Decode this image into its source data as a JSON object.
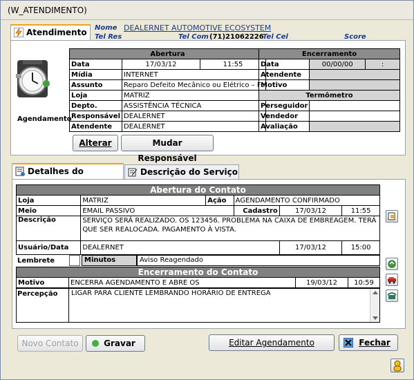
{
  "window": {
    "title": "(W_ATENDIMENTO)"
  },
  "tab_atendimento": {
    "label": "Atendimento"
  },
  "header": {
    "nome_label": "Nome",
    "nome_value": "DEALERNET AUTOMOTIVE ECOSYSTEM",
    "telres_label": "Tel Res",
    "telcom_label": "Tel Com",
    "telcom_value": "(71)21062226",
    "telcel_label": "Tel Cel",
    "score_label": "Score"
  },
  "agendamento_label": "Agendamento",
  "abertura": {
    "title": "Abertura",
    "data_label": "Data",
    "data_value": "17/03/12",
    "hora_value": "11:55",
    "midia_label": "Mídia",
    "midia_value": "INTERNET",
    "assunto_label": "Assunto",
    "assunto_value": "Reparo Defeito Mecânico ou Elétrico – Fo",
    "loja_label": "Loja",
    "loja_value": "MATRIZ",
    "depto_label": "Depto.",
    "depto_value": "ASSISTÊNCIA TÉCNICA",
    "responsavel_label": "Responsável",
    "responsavel_value": "DEALERNET",
    "atendente_label": "Atendente",
    "atendente_value": "DEALERNET"
  },
  "encerramento": {
    "title": "Encerramento",
    "data_label": "Data",
    "data_value": "00/00/00",
    "hora_value": ":",
    "atendente_label": "Atendente",
    "motivo_label": "Motivo",
    "termometro_title": "Termômetro",
    "perseguidor_label": "Perseguidor",
    "vendedor_label": "Vendedor",
    "avaliacao_label": "Avaliação"
  },
  "buttons": {
    "alterar": "Alterar",
    "mudar_responsavel": "Mudar Responsável",
    "novo_contato": "Novo Contato",
    "gravar": "Gravar",
    "editar_agendamento": "Editar Agendamento",
    "fechar": "Fechar"
  },
  "tabs2": {
    "detalhes": "Detalhes do Contato",
    "descricao": "Descrição do Serviço"
  },
  "contato": {
    "abertura_title": "Abertura do Contato",
    "loja_label": "Loja",
    "loja_value": "MATRIZ",
    "acao_label": "Ação",
    "acao_value": "AGENDAMENTO CONFIRMADO",
    "meio_label": "Meio",
    "meio_value": "EMAIL PASSIVO",
    "cadastro_label": "Cadastro",
    "cadastro_date": "17/03/12",
    "cadastro_time": "11:55",
    "descricao_label": "Descrição",
    "descricao_value": "SERVIÇO SERÁ REALIZADO. OS 123456. PROBLEMA NA CAIXA DE EMBREAGEM. TERÁ QUE SER REALOCADA. PAGAMENTO À VISTA.",
    "usuario_label": "Usuário/Data",
    "usuario_value": "DEALERNET",
    "usuario_date": "17/03/12",
    "usuario_time": "15:00",
    "lembrete_label": "Lembrete",
    "minutos_label": "Minutos Antes",
    "minutos_value": "Aviso Reagendado",
    "encerramento_title": "Encerramento do Contato",
    "motivo_label": "Motivo",
    "motivo_value": "ENCERRA AGENDAMENTO E ABRE OS",
    "motivo_date": "19/03/12",
    "motivo_time": "10:59",
    "percepcao_label": "Percepção",
    "percepcao_value": "LIGAR PARA CLIENTE LEMBRANDO HORÁRIO DE ENTREGA"
  }
}
